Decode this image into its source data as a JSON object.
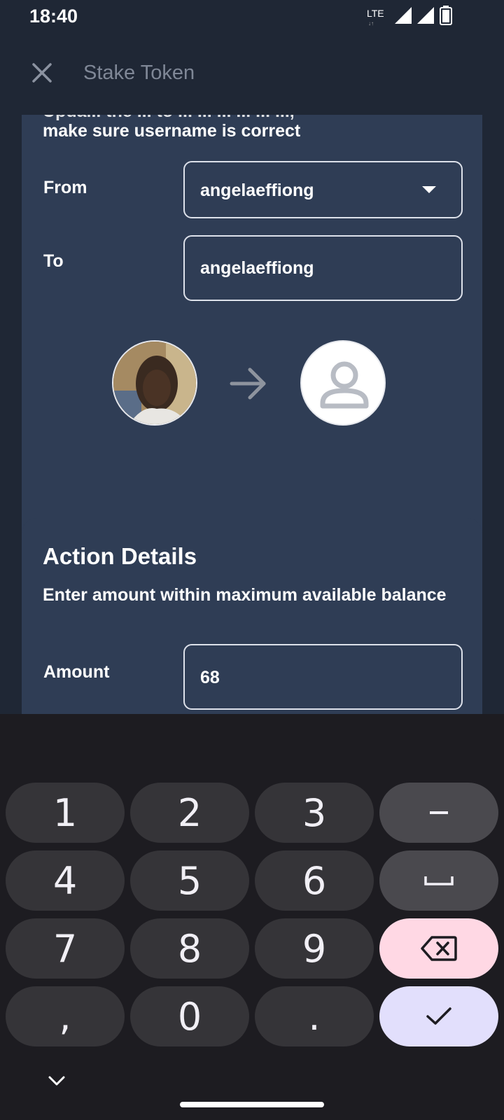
{
  "status_bar": {
    "time": "18:40",
    "network": "LTE",
    "icons": [
      "lte-icon",
      "signal-icon",
      "signal-icon",
      "battery-icon"
    ]
  },
  "app_bar": {
    "title": "Stake Token",
    "close_icon": "close-icon"
  },
  "transfer_card": {
    "note_partial": "Upda... the ... to ... ... ... ... ... ...,",
    "note": "make sure username is correct",
    "from_label": "From",
    "from_value": "angelaeffiong",
    "to_label": "To",
    "to_value": "angelaeffiong",
    "arrow_icon": "arrow-right-icon",
    "to_avatar_icon": "person-icon"
  },
  "action_details": {
    "title": "Action Details",
    "subtitle": "Enter amount within maximum available balance",
    "amount_label": "Amount",
    "amount_value": "68"
  },
  "keyboard": {
    "keys": [
      [
        "1",
        "2",
        "3",
        "−"
      ],
      [
        "4",
        "5",
        "6",
        "space"
      ],
      [
        "7",
        "8",
        "9",
        "backspace"
      ],
      [
        ",",
        "0",
        ".",
        "done"
      ]
    ],
    "collapse_icon": "chevron-down-icon"
  },
  "colors": {
    "background": "#1f2735",
    "card": "#2f3d55",
    "keyboard": "#1d1c21",
    "key": "#353438",
    "delete_key": "#ffd8e4",
    "done_key": "#e2dffc"
  }
}
